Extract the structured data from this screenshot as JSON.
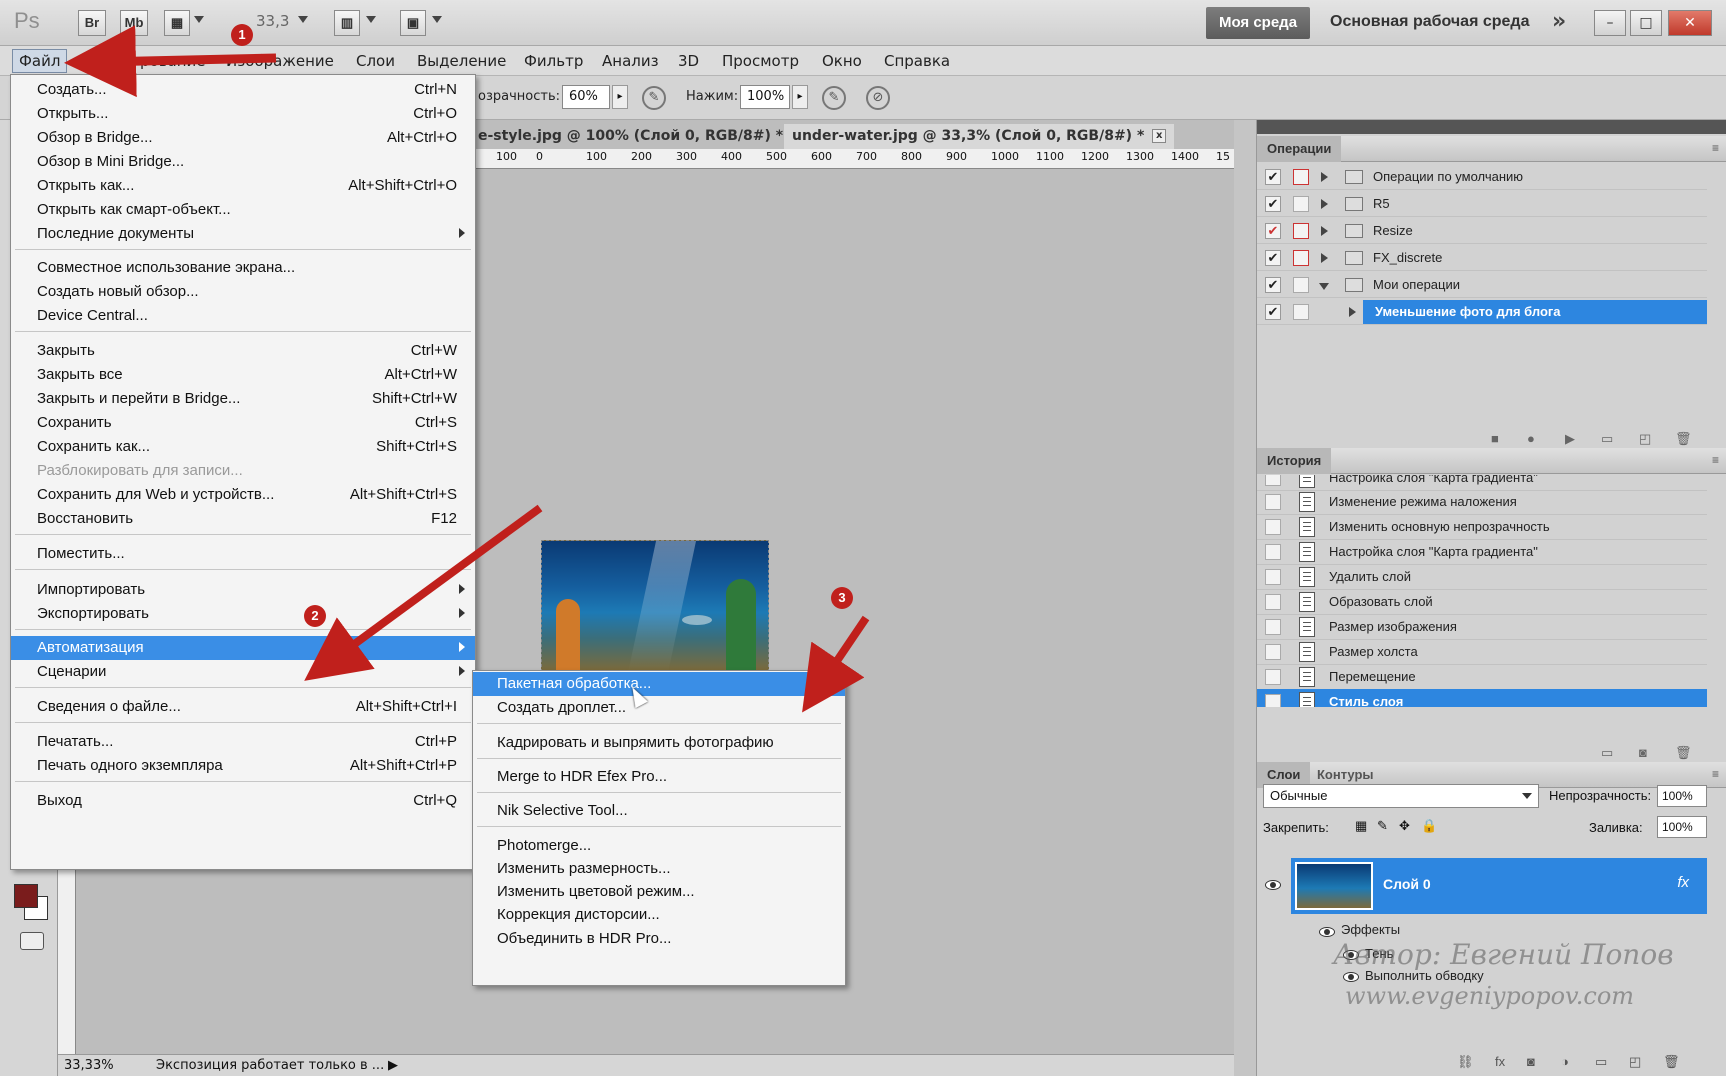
{
  "app": {
    "logo": "Ps",
    "tb_br": "Br",
    "tb_mb": "Mb",
    "zoom": "33,3",
    "workspace_btn": "Моя среда",
    "workspace_name": "Основная рабочая среда",
    "more": "»",
    "win_min": "–",
    "win_max": "□",
    "win_close": "✕"
  },
  "menubar": {
    "file": "Файл",
    "edit_partial": "Р",
    "edit_tail": "рование",
    "image": "Изображение",
    "layers": "Слои",
    "select": "Выделение",
    "filter": "Фильтр",
    "analysis": "Анализ",
    "three_d": "3D",
    "view": "Просмотр",
    "window": "Окно",
    "help": "Справка"
  },
  "options": {
    "opacity_label": "озрачность:",
    "opacity_value": "60%",
    "pressure_label": "Нажим:",
    "pressure_value": "100%"
  },
  "tabs": {
    "tab1": "e-style.jpg @ 100% (Слой 0, RGB/8#) *",
    "tab2": "under-water.jpg @ 33,3% (Слой 0, RGB/8#) *",
    "close": "x"
  },
  "ruler": {
    "ticks": [
      "100",
      "0",
      "100",
      "200",
      "300",
      "400",
      "500",
      "600",
      "700",
      "800",
      "900",
      "1000",
      "1100",
      "1200",
      "1300",
      "1400",
      "15"
    ]
  },
  "file_menu": {
    "items": [
      {
        "label": "Создать...",
        "shortcut": "Ctrl+N"
      },
      {
        "label": "Открыть...",
        "shortcut": "Ctrl+O"
      },
      {
        "label": "Обзор в Bridge...",
        "shortcut": "Alt+Ctrl+O"
      },
      {
        "label": "Обзор в Mini Bridge...",
        "shortcut": ""
      },
      {
        "label": "Открыть как...",
        "shortcut": "Alt+Shift+Ctrl+O"
      },
      {
        "label": "Открыть как смарт-объект...",
        "shortcut": ""
      },
      {
        "label": "Последние документы",
        "shortcut": ""
      },
      {
        "label": "Совместное использование экрана...",
        "shortcut": ""
      },
      {
        "label": "Создать новый обзор...",
        "shortcut": ""
      },
      {
        "label": "Device Central...",
        "shortcut": ""
      },
      {
        "label": "Закрыть",
        "shortcut": "Ctrl+W"
      },
      {
        "label": "Закрыть все",
        "shortcut": "Alt+Ctrl+W"
      },
      {
        "label": "Закрыть и перейти в Bridge...",
        "shortcut": "Shift+Ctrl+W"
      },
      {
        "label": "Сохранить",
        "shortcut": "Ctrl+S"
      },
      {
        "label": "Сохранить как...",
        "shortcut": "Shift+Ctrl+S"
      },
      {
        "label": "Разблокировать для записи...",
        "shortcut": ""
      },
      {
        "label": "Сохранить для Web и устройств...",
        "shortcut": "Alt+Shift+Ctrl+S"
      },
      {
        "label": "Восстановить",
        "shortcut": "F12"
      },
      {
        "label": "Поместить...",
        "shortcut": ""
      },
      {
        "label": "Импортировать",
        "shortcut": ""
      },
      {
        "label": "Экспортировать",
        "shortcut": ""
      },
      {
        "label": "Автоматизация",
        "shortcut": ""
      },
      {
        "label": "Сценарии",
        "shortcut": ""
      },
      {
        "label": "Сведения о файле...",
        "shortcut": "Alt+Shift+Ctrl+I"
      },
      {
        "label": "Печатать...",
        "shortcut": "Ctrl+P"
      },
      {
        "label": "Печать одного экземпляра",
        "shortcut": "Alt+Shift+Ctrl+P"
      },
      {
        "label": "Выход",
        "shortcut": "Ctrl+Q"
      }
    ]
  },
  "automation_menu": {
    "items": [
      "Пакетная обработка...",
      "Создать дроплет...",
      "Кадрировать и выпрямить фотографию",
      "Merge to HDR Efex Pro...",
      "Nik Selective Tool...",
      "Photomerge...",
      "Изменить размерность...",
      "Изменить цветовой режим...",
      "Коррекция дисторсии...",
      "Объединить в HDR Pro..."
    ]
  },
  "annotations": {
    "n1": "1",
    "n2": "2",
    "n3": "3",
    "color": "#c0201c"
  },
  "actions_panel": {
    "title": "Операции",
    "rows": [
      {
        "name": "Операции по умолчанию"
      },
      {
        "name": "R5"
      },
      {
        "name": "Resize"
      },
      {
        "name": "FX_discrete"
      },
      {
        "name": "Мои операции"
      },
      {
        "name": "Уменьшение фото для блога"
      }
    ],
    "check": "✔"
  },
  "history_panel": {
    "title": "История",
    "rows": [
      "Настройка слоя \"Карта градиента\"",
      "Изменение режима наложения",
      "Изменить основную непрозрачность",
      "Настройка слоя \"Карта градиента\"",
      "Удалить слой",
      "Образовать слой",
      "Размер изображения",
      "Размер холста",
      "Перемещение",
      "Стиль слоя"
    ]
  },
  "layers_panel": {
    "tab_layers": "Слои",
    "tab_paths": "Контуры",
    "blend_mode": "Обычные",
    "opacity_label": "Непрозрачность:",
    "opacity_value": "100%",
    "lock_label": "Закрепить:",
    "fill_label": "Заливка:",
    "fill_value": "100%",
    "layer_name": "Слой 0",
    "fx": "fx",
    "effects": "Эффекты",
    "shadow": "Тень",
    "stroke": "Выполнить обводку"
  },
  "watermark": {
    "line1": "Автор: Евгений Попов",
    "line2": "www.evgeniypopov.com"
  },
  "status": {
    "zoom": "33,33%",
    "text": "Экспозиция работает только в ..."
  },
  "colors": {
    "accent": "#3a8ee6",
    "foreground_swatch": "#7a1c1c",
    "arrow_red": "#c0201c"
  }
}
